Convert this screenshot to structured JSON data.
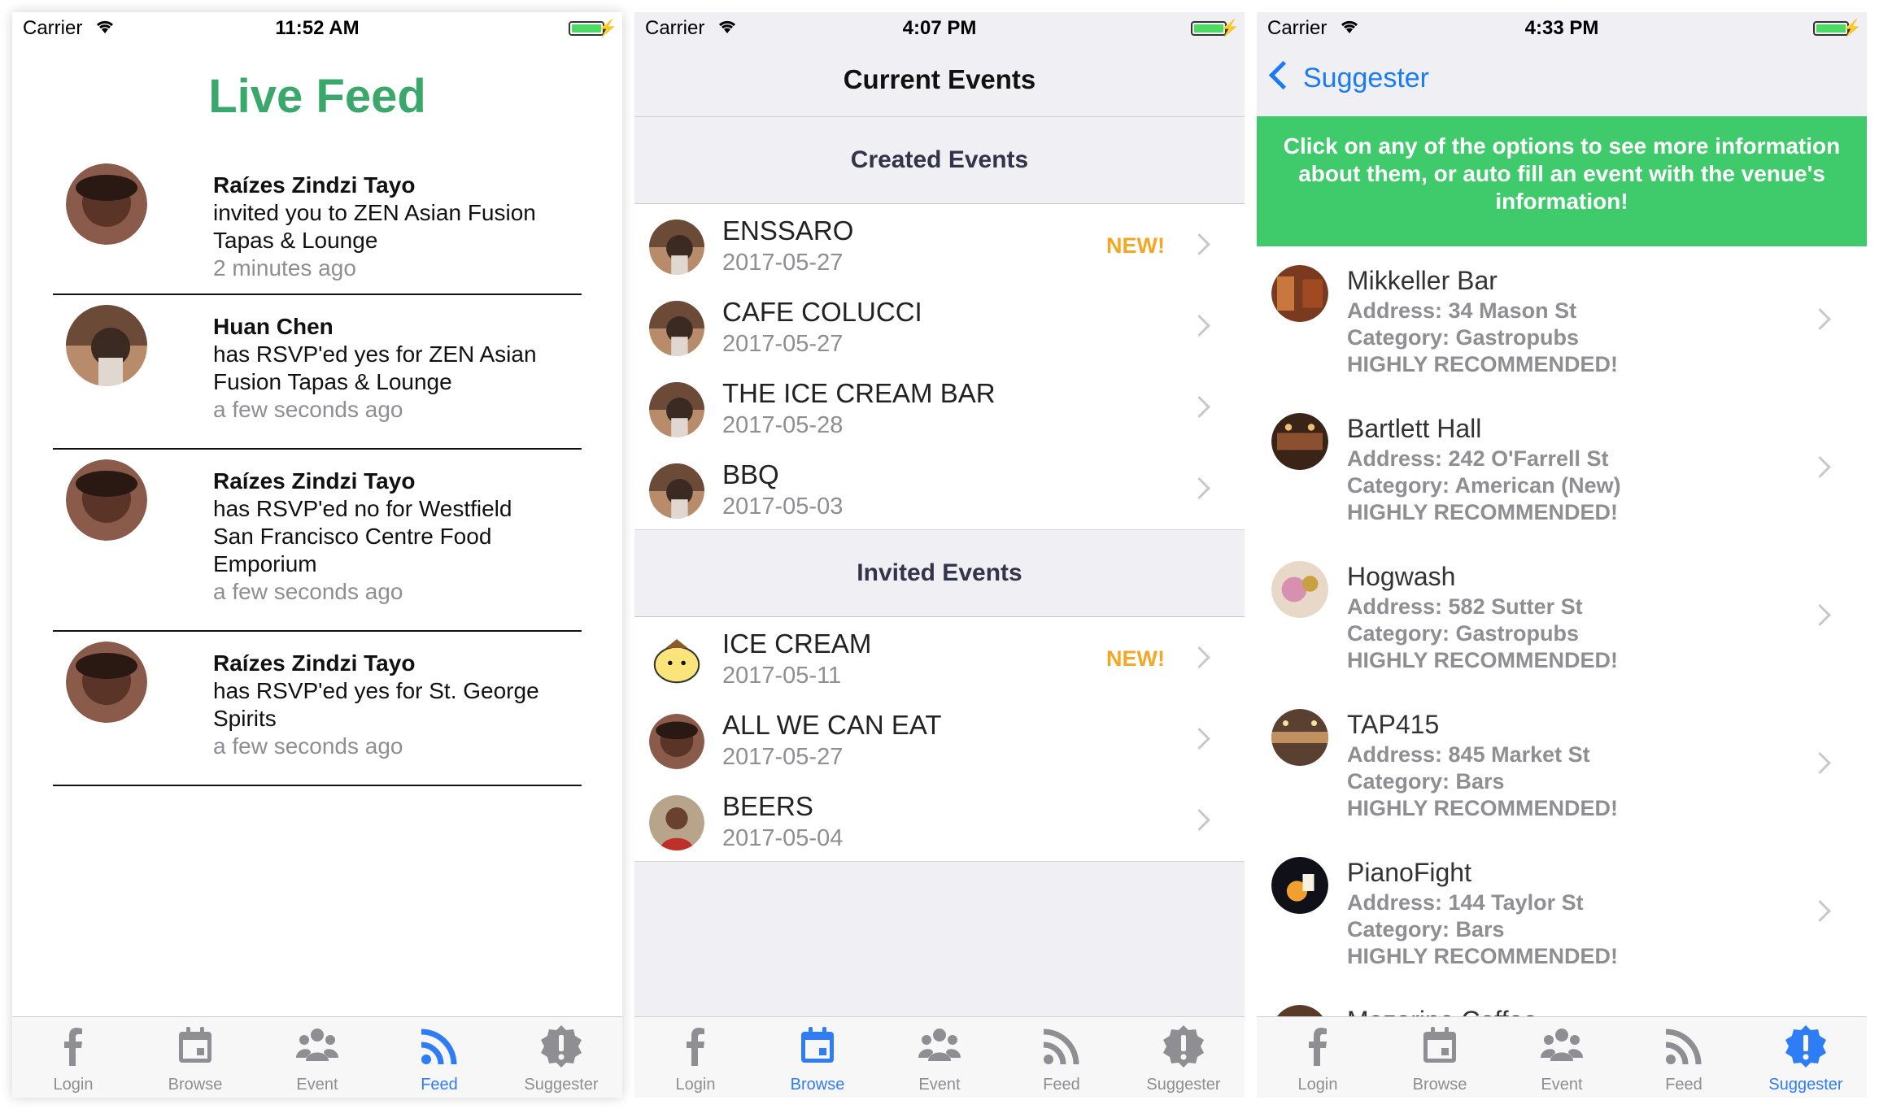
{
  "colors": {
    "green_title": "#3aa86b",
    "banner_green": "#3fcb6b",
    "ios_blue": "#1a7cf5",
    "new_orange": "#f5a623",
    "tab_gray": "#8e8e93"
  },
  "status_bars": [
    {
      "carrier": "Carrier",
      "time": "11:52 AM"
    },
    {
      "carrier": "Carrier",
      "time": "4:07 PM"
    },
    {
      "carrier": "Carrier",
      "time": "4:33 PM"
    }
  ],
  "tabs": [
    {
      "label": "Login",
      "icon": "facebook-icon"
    },
    {
      "label": "Browse",
      "icon": "calendar-icon"
    },
    {
      "label": "Event",
      "icon": "people-icon"
    },
    {
      "label": "Feed",
      "icon": "rss-icon"
    },
    {
      "label": "Suggester",
      "icon": "alert-badge-icon"
    }
  ],
  "live_feed": {
    "title": "Live Feed",
    "items": [
      {
        "name": "Raízes Zindzi Tayo",
        "message": " invited you to ZEN Asian Fusion Tapas & Lounge",
        "time": "2 minutes ago"
      },
      {
        "name": "Huan Chen",
        "message": " has RSVP'ed yes for ZEN Asian Fusion Tapas & Lounge",
        "time": "a few seconds ago"
      },
      {
        "name": "Raízes Zindzi Tayo",
        "message": " has RSVP'ed no for Westfield San Francisco Centre Food Emporium",
        "time": "a few seconds ago"
      },
      {
        "name": "Raízes Zindzi Tayo",
        "message": " has RSVP'ed yes for St. George Spirits",
        "time": "a few seconds ago"
      }
    ]
  },
  "browse": {
    "title": "Current Events",
    "created_header": "Created Events",
    "created": [
      {
        "name": "ENSSARO",
        "date": "2017-05-27",
        "badge": "NEW!"
      },
      {
        "name": "CAFE COLUCCI",
        "date": "2017-05-27",
        "badge": ""
      },
      {
        "name": "THE ICE CREAM BAR",
        "date": "2017-05-28",
        "badge": ""
      },
      {
        "name": "BBQ",
        "date": "2017-05-03",
        "badge": ""
      }
    ],
    "invited_header": "Invited Events",
    "invited": [
      {
        "name": "ICE CREAM",
        "date": "2017-05-11",
        "badge": "NEW!"
      },
      {
        "name": "ALL WE CAN EAT",
        "date": "2017-05-27",
        "badge": ""
      },
      {
        "name": "BEERS",
        "date": "2017-05-04",
        "badge": ""
      }
    ]
  },
  "suggester": {
    "back_label": "Suggester",
    "banner": "Click on any of the options to see more information about them, or auto fill an event with the venue's information!",
    "venues": [
      {
        "name": "Mikkeller Bar",
        "address": "Address: 34 Mason St",
        "category": "Category: Gastropubs",
        "rec": "HIGHLY RECOMMENDED!"
      },
      {
        "name": "Bartlett Hall",
        "address": "Address: 242 O'Farrell St",
        "category": "Category: American (New)",
        "rec": "HIGHLY RECOMMENDED!"
      },
      {
        "name": "Hogwash",
        "address": "Address: 582 Sutter St",
        "category": "Category: Gastropubs",
        "rec": "HIGHLY RECOMMENDED!"
      },
      {
        "name": "TAP415",
        "address": "Address: 845 Market St",
        "category": "Category: Bars",
        "rec": "HIGHLY RECOMMENDED!"
      },
      {
        "name": "PianoFight",
        "address": "Address: 144 Taylor St",
        "category": "Category: Bars",
        "rec": "HIGHLY RECOMMENDED!"
      },
      {
        "name": "Mazarine Coffee",
        "address": "",
        "category": "",
        "rec": ""
      }
    ]
  }
}
